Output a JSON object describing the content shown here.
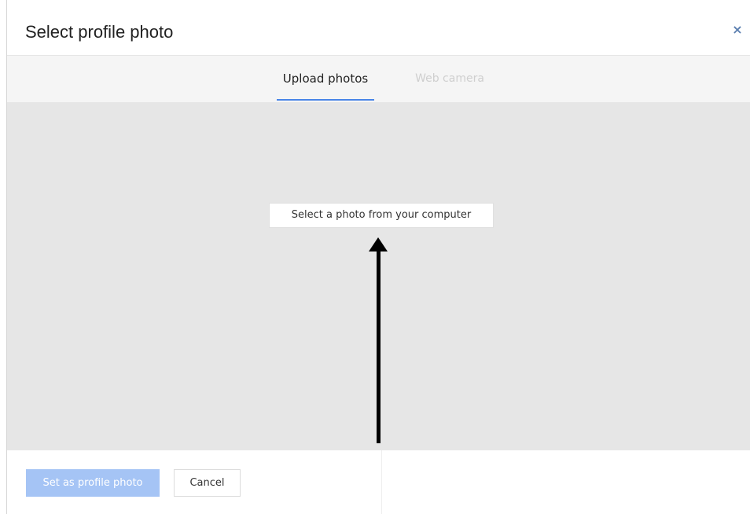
{
  "dialog": {
    "title": "Select profile photo",
    "close_label": "×"
  },
  "tabs": [
    {
      "label": "Upload photos",
      "active": true
    },
    {
      "label": "Web camera",
      "active": false
    }
  ],
  "upload": {
    "select_button_label": "Select a photo from your computer",
    "arrow_icon": "up-arrow-icon"
  },
  "footer": {
    "set_button_label": "Set as profile photo",
    "cancel_button_label": "Cancel"
  },
  "colors": {
    "accent": "#4a86e8",
    "set_button_disabled": "#a5c4f5",
    "upload_area_bg": "#e6e6e6",
    "tab_bar_bg": "#f5f5f5",
    "close_icon": "#5b7fb0"
  }
}
